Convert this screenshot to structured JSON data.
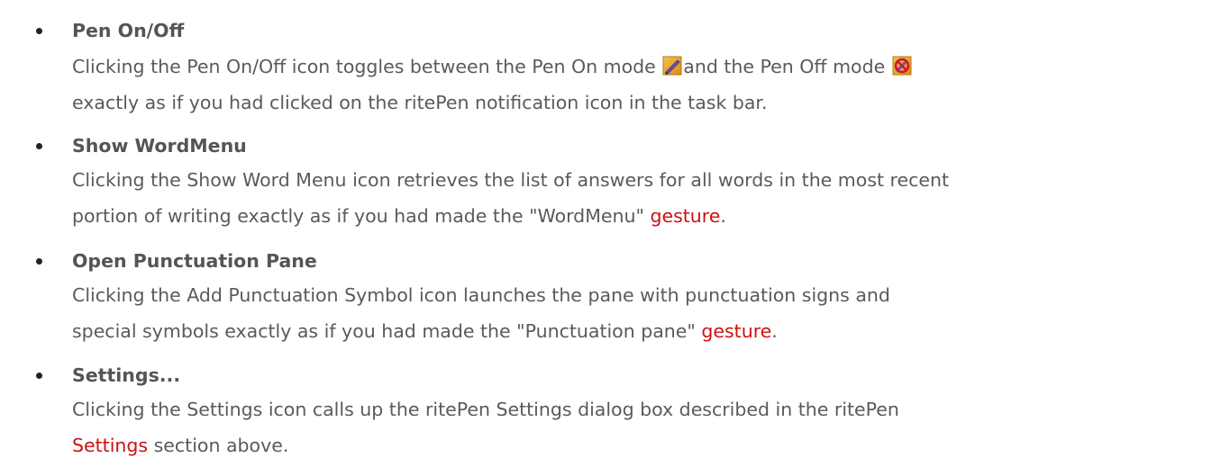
{
  "items": [
    {
      "title": "Pen On/Off",
      "line1_a": "Clicking the Pen On/Off icon toggles between the Pen On mode ",
      "line1_b": "and the Pen Off mode ",
      "line2": "exactly as if you had clicked on the ritePen notification icon in the task bar.",
      "icons": [
        "pen-on-icon",
        "pen-off-icon"
      ]
    },
    {
      "title": "Show WordMenu",
      "line1": "Clicking the Show Word Menu icon retrieves the list of answers for all words in the most recent",
      "line2_a": "portion of writing exactly as if you had made the \"WordMenu\" ",
      "line2_link": "gesture",
      "line2_b": "."
    },
    {
      "title": "Open Punctuation Pane",
      "line1": "Clicking the Add Punctuation Symbol icon launches the pane with punctuation signs and",
      "line2_a": "special symbols exactly as if you had made the \"Punctuation pane\" ",
      "line2_link": "gesture",
      "line2_b": "."
    },
    {
      "title": "Settings...",
      "line1": "Clicking the Settings icon calls up the ritePen Settings dialog box described in the ritePen",
      "line2_link": "Settings",
      "line2_b": " section above."
    }
  ],
  "colors": {
    "text": "#5a5a5a",
    "link": "#cc1111",
    "bullet": "#222222"
  }
}
